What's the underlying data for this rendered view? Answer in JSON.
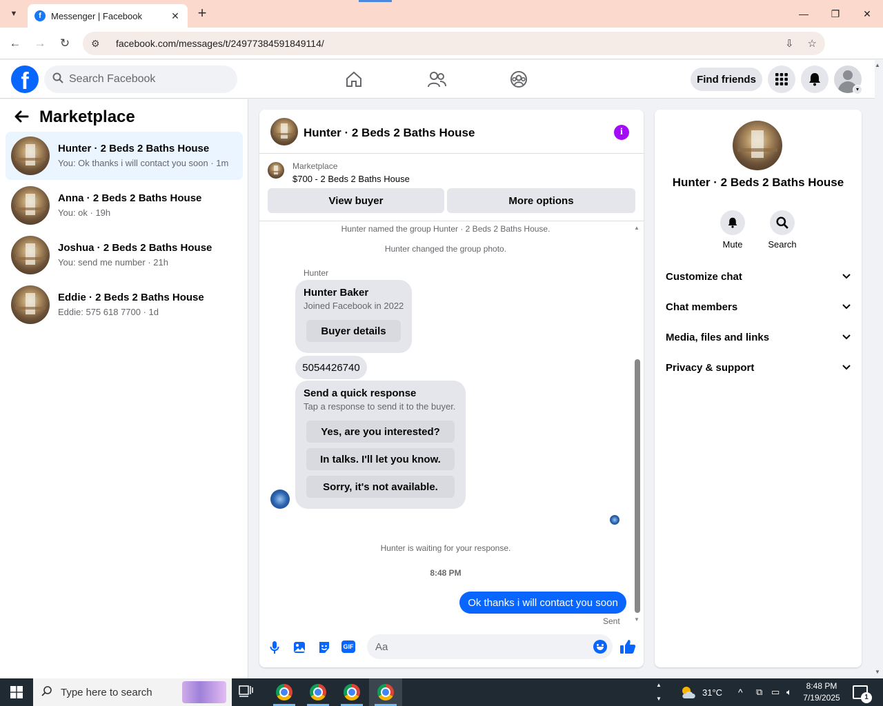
{
  "browser": {
    "tab_title": "Messenger | Facebook",
    "url": "facebook.com/messages/t/24977384591849114/",
    "colors": {
      "tabbar": "#fbd9cc"
    }
  },
  "fb_header": {
    "search_placeholder": "Search Facebook",
    "find_friends_label": "Find friends",
    "logo_letter": "f"
  },
  "sidebar": {
    "title": "Marketplace",
    "conversations": [
      {
        "name": "Hunter · 2 Beds 2 Baths House",
        "snippet": "You: Ok thanks i will contact you soon · 1m",
        "active": true
      },
      {
        "name": "Anna · 2 Beds 2 Baths House",
        "snippet": "You: ok · 19h",
        "active": false
      },
      {
        "name": "Joshua · 2 Beds 2 Baths House",
        "snippet": "You: send me number · 21h",
        "active": false
      },
      {
        "name": "Eddie · 2 Beds 2 Baths House",
        "snippet": "Eddie: 575 618 7700 · 1d",
        "active": false
      }
    ]
  },
  "chat": {
    "title": "Hunter · 2 Beds 2 Baths House",
    "listing_source": "Marketplace",
    "listing_price": "$700 - 2 Beds 2 Baths House",
    "view_buyer_label": "View buyer",
    "more_options_label": "More options",
    "system_messages": {
      "named_group": "Hunter named the group Hunter · 2 Beds 2 Baths House.",
      "changed_photo": "Hunter changed the group photo.",
      "waiting": "Hunter is waiting for your response.",
      "time": "8:48 PM"
    },
    "sender_label": "Hunter",
    "buyer_card": {
      "name": "Hunter Baker",
      "joined": "Joined Facebook in 2022",
      "button_label": "Buyer details"
    },
    "phone_message": "5054426740",
    "quick_response": {
      "title": "Send a quick response",
      "subtitle": "Tap a response to send it to the buyer.",
      "options": [
        "Yes, are you interested?",
        "In talks. I'll let you know.",
        "Sorry, it's not available."
      ]
    },
    "sent_message": "Ok thanks i will contact you soon",
    "sent_status": "Sent",
    "composer_placeholder": "Aa",
    "gif_label": "GIF",
    "colors": {
      "accent": "#0866ff",
      "info": "#a40cf7"
    }
  },
  "details": {
    "title": "Hunter · 2 Beds 2 Baths House",
    "actions": [
      {
        "label": "Mute",
        "icon": "bell-icon"
      },
      {
        "label": "Search",
        "icon": "search-icon"
      }
    ],
    "sections": [
      "Customize chat",
      "Chat members",
      "Media, files and links",
      "Privacy & support"
    ]
  },
  "taskbar": {
    "search_placeholder": "Type here to search",
    "weather": "31°C",
    "time": "8:48 PM",
    "date": "7/19/2025",
    "notification_count": "1"
  }
}
